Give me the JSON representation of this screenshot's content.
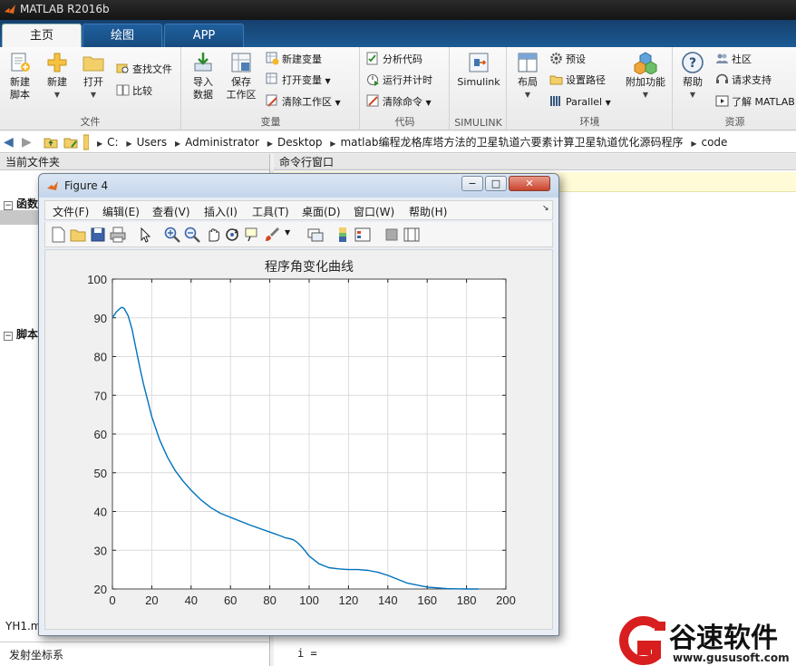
{
  "window": {
    "title": "MATLAB R2016b"
  },
  "ribbon": {
    "tabs": [
      {
        "label": "主页"
      },
      {
        "label": "绘图"
      },
      {
        "label": "APP"
      }
    ],
    "sections": {
      "file": {
        "label": "文件",
        "new_script": "新建\n脚本",
        "new": "新建",
        "open": "打开",
        "find_files": "查找文件",
        "compare": "比较"
      },
      "variable": {
        "label": "变量",
        "import": "导入\n数据",
        "save_ws": "保存\n工作区",
        "new_var": "新建变量",
        "open_var": "打开变量",
        "clear_ws": "清除工作区"
      },
      "code": {
        "label": "代码",
        "analyze": "分析代码",
        "run_time": "运行并计时",
        "clear_cmd": "清除命令"
      },
      "simulink": {
        "label": "SIMULINK",
        "simulink": "Simulink"
      },
      "env": {
        "label": "环境",
        "layout": "布局",
        "prefs": "预设",
        "set_path": "设置路径",
        "parallel": "Parallel",
        "addons": "附加功能"
      },
      "resources": {
        "label": "资源",
        "help": "帮助",
        "community": "社区",
        "support": "请求支持",
        "learn": "了解 MATLAB"
      }
    }
  },
  "address": {
    "crumbs": [
      "C:",
      "Users",
      "Administrator",
      "Desktop",
      "matlab编程龙格库塔方法的卫星轨道六要素计算卫星轨道优化源码程序",
      "code"
    ]
  },
  "left_panel": {
    "title": "当前文件夹",
    "group_functions": "函数",
    "group_scripts": "脚本",
    "file_bottom": "YH1.m",
    "detail_text": "发射坐标系"
  },
  "command_panel": {
    "title": "命令行窗口",
    "output": "i ="
  },
  "figure": {
    "title": "Figure 4",
    "menu": [
      "文件(F)",
      "编辑(E)",
      "查看(V)",
      "插入(I)",
      "工具(T)",
      "桌面(D)",
      "窗口(W)",
      "帮助(H)"
    ]
  },
  "chart_data": {
    "type": "line",
    "title": "程序角变化曲线",
    "xlabel": "",
    "ylabel": "",
    "xlim": [
      0,
      200
    ],
    "ylim": [
      20,
      100
    ],
    "xticks": [
      0,
      20,
      40,
      60,
      80,
      100,
      120,
      140,
      160,
      180,
      200
    ],
    "yticks": [
      20,
      30,
      40,
      50,
      60,
      70,
      80,
      90,
      100
    ],
    "grid": true,
    "color": "#0072bd",
    "series": [
      {
        "x": [
          0,
          2,
          4,
          5,
          6,
          8,
          10,
          12,
          14,
          16,
          18,
          20,
          24,
          28,
          32,
          36,
          40,
          45,
          50,
          55,
          60,
          70,
          80,
          85,
          88,
          90,
          92,
          94,
          96,
          98,
          100,
          105,
          110,
          115,
          120,
          125,
          130,
          135,
          140,
          150,
          160,
          170,
          180,
          186
        ],
        "y": [
          90,
          91.5,
          92.5,
          92.7,
          92.4,
          90.5,
          87,
          82,
          77,
          72.5,
          68.5,
          64.5,
          58.5,
          54,
          50.5,
          47.8,
          45.5,
          43,
          41,
          39.5,
          38.5,
          36.5,
          34.7,
          33.8,
          33.2,
          33,
          32.7,
          32,
          31,
          29.8,
          28.5,
          26.5,
          25.5,
          25.2,
          25,
          25,
          24.8,
          24.3,
          23.5,
          21.5,
          20.5,
          20.1,
          20,
          20
        ]
      }
    ]
  },
  "watermark": {
    "text": "谷速软件",
    "url": "www.gususoft.com"
  }
}
